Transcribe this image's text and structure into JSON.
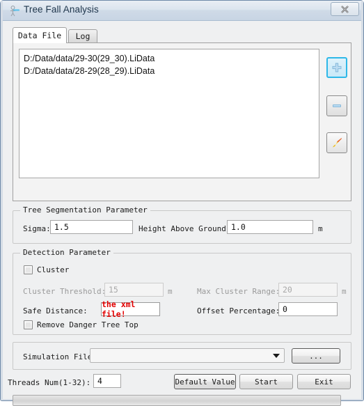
{
  "window": {
    "title": "Tree Fall Analysis",
    "app_icon": "tree-figure-icon",
    "close_label": "✕"
  },
  "tabs": [
    {
      "label": "Data File",
      "active": true
    },
    {
      "label": "Log",
      "active": false
    }
  ],
  "data_file_tab": {
    "file_list": [
      "D:/Data/data/29-30(29_30).LiData",
      "D:/Data/data/28-29(28_29).LiData"
    ],
    "tools": [
      {
        "name": "add-file-button",
        "icon": "plus-icon",
        "glyph": "✚"
      },
      {
        "name": "remove-file-button",
        "icon": "minus-icon",
        "glyph": "➖"
      },
      {
        "name": "clear-list-button",
        "icon": "brush-icon",
        "glyph": "✎"
      }
    ]
  },
  "tree_segmentation": {
    "title": "Tree Segmentation Parameter",
    "sigma_label": "Sigma:",
    "sigma_value": "1.5",
    "height_label": "Height Above Ground:",
    "height_value": "1.0",
    "height_unit": "m"
  },
  "detection": {
    "title": "Detection Parameter",
    "cluster_checkbox_label": "Cluster",
    "cluster_checked": false,
    "cluster_threshold_label": "Cluster Threshold:",
    "cluster_threshold_value": "15",
    "cluster_threshold_unit": "m",
    "max_cluster_range_label": "Max Cluster Range:",
    "max_cluster_range_value": "20",
    "max_cluster_range_unit": "m",
    "safe_distance_label": "Safe Distance:",
    "safe_distance_value": "the xml file!",
    "safe_distance_color": "#e20000",
    "offset_percentage_label": "Offset Percentage:",
    "offset_percentage_value": "0",
    "remove_danger_label": "Remove Danger Tree Top",
    "remove_danger_checked": false
  },
  "simulation": {
    "label": "Simulation File:",
    "value": "",
    "browse_label": "..."
  },
  "bottom": {
    "threads_label": "Threads Num(1-32):",
    "threads_value": "4",
    "default_value_label": "Default Value",
    "start_label": "Start",
    "exit_label": "Exit"
  },
  "progress": {
    "percent": 0
  }
}
